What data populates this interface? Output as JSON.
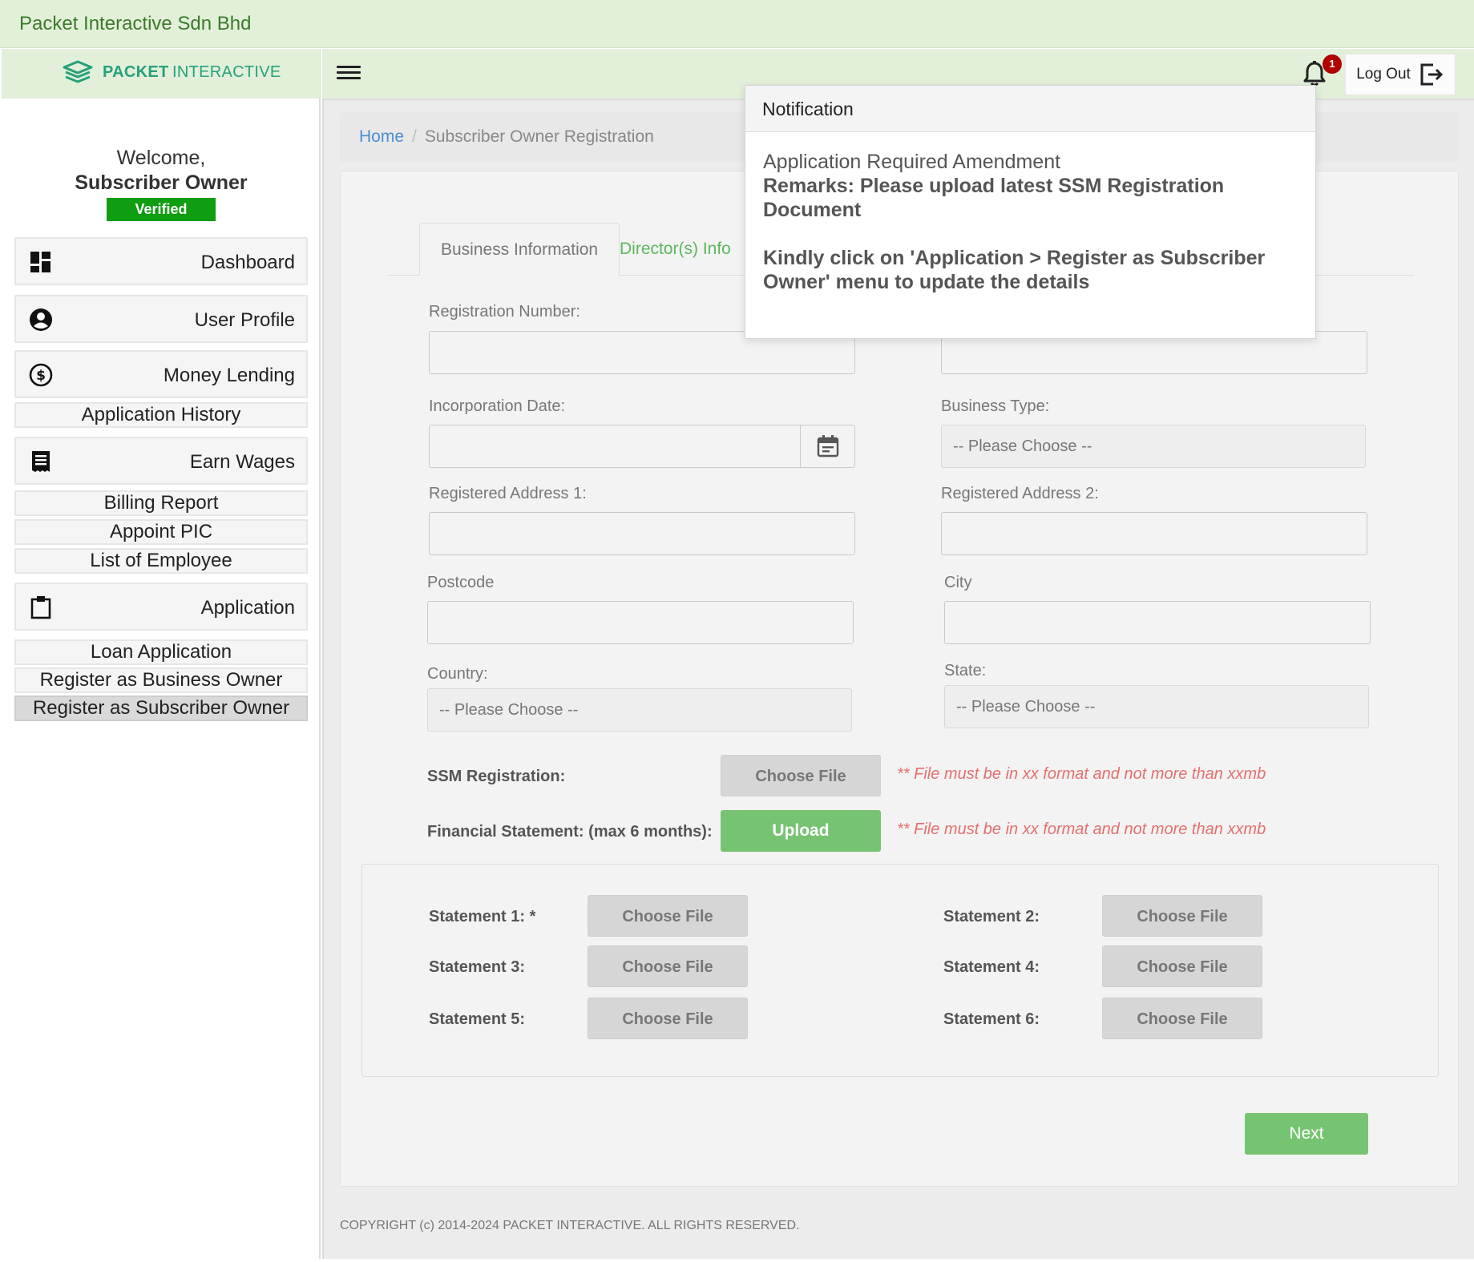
{
  "app": {
    "company_name": "Packet Interactive Sdn Bhd",
    "logo_strong": "PACKET",
    "logo_light": "INTERACTIVE"
  },
  "header": {
    "notification_count": "1",
    "logout_label": "Log Out"
  },
  "sidebar": {
    "welcome": "Welcome,",
    "role": "Subscriber Owner",
    "status_badge": "Verified",
    "items": {
      "dashboard": "Dashboard",
      "user_profile": "User Profile",
      "money_lending": "Money Lending",
      "application_history": "Application History",
      "earn_wages": "Earn Wages",
      "billing_report": "Billing Report",
      "appoint_pic": "Appoint PIC",
      "list_of_employee": "List of Employee",
      "application": "Application",
      "loan_application": "Loan Application",
      "register_business_owner": "Register as Business Owner",
      "register_subscriber_owner": "Register as Subscriber Owner"
    }
  },
  "breadcrumb": {
    "home": "Home",
    "separator": "/",
    "current": "Subscriber Owner Registration"
  },
  "tabs": {
    "business_information": "Business Information",
    "directors_info": "Director(s) Info"
  },
  "form": {
    "registration_number_label": "Registration Number:",
    "incorporation_date_label": "Incorporation Date:",
    "business_type_label": "Business Type:",
    "business_type_value": "-- Please Choose --",
    "registered_address1_label": "Registered Address 1:",
    "registered_address2_label": "Registered Address 2:",
    "postcode_label": "Postcode",
    "city_label": "City",
    "country_label": "Country:",
    "country_value": "-- Please Choose --",
    "state_label": "State:",
    "state_value": "-- Please Choose --",
    "ssm_label": "SSM Registration:",
    "choose_file": "Choose File",
    "financial_label": "Financial Statement: (max 6 months):",
    "upload_label": "Upload",
    "file_hint": "** File must be in xx format and not more than xxmb",
    "statements": {
      "s1": "Statement 1: *",
      "s2": "Statement 2:",
      "s3": "Statement 3:",
      "s4": "Statement 4:",
      "s5": "Statement 5:",
      "s6": "Statement 6:"
    },
    "next_label": "Next"
  },
  "footer": {
    "copyright": "COPYRIGHT (c) 2014-2024 PACKET INTERACTIVE. ALL RIGHTS RESERVED."
  },
  "notification": {
    "title": "Notification",
    "heading": "Application Required Amendment",
    "remarks": "Remarks: Please upload latest SSM Registration Document",
    "instruction": "Kindly click on 'Application > Register as Subscriber Owner' menu to update the details"
  },
  "colors": {
    "header_bg": "#e2f0d9",
    "brand": "#27a07a",
    "verified": "#0f9d12",
    "accent_green": "#76c472",
    "badge": "#b00000",
    "hint_red": "#e56f6f"
  }
}
